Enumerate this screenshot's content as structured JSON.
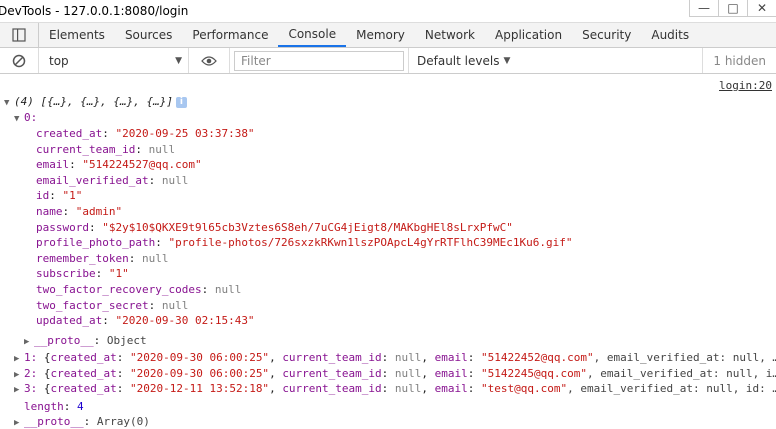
{
  "window": {
    "title": "DevTools - 127.0.0.1:8080/login",
    "min": "—",
    "max": "□",
    "close": "✕"
  },
  "tabs": [
    "Elements",
    "Sources",
    "Performance",
    "Console",
    "Memory",
    "Network",
    "Application",
    "Security",
    "Audits"
  ],
  "active_tab": "Console",
  "toolbar": {
    "context": "top",
    "filter_placeholder": "Filter",
    "levels": "Default levels",
    "hidden": "1 hidden"
  },
  "console": {
    "source": "login:20",
    "summary": "(4) [{…}, {…}, {…}, {…}]",
    "item0_key": "0:",
    "fields": [
      {
        "key": "created_at",
        "value": "\"2020-09-25 03:37:38\"",
        "type": "string"
      },
      {
        "key": "current_team_id",
        "value": "null",
        "type": "null"
      },
      {
        "key": "email",
        "value": "\"514224527@qq.com\"",
        "type": "string"
      },
      {
        "key": "email_verified_at",
        "value": "null",
        "type": "null"
      },
      {
        "key": "id",
        "value": "\"1\"",
        "type": "string"
      },
      {
        "key": "name",
        "value": "\"admin\"",
        "type": "string"
      },
      {
        "key": "password",
        "value": "\"$2y$10$QKXE9t9l65cb3Vztes6S8eh/7uCG4jEigt8/MAKbgHEl8sLrxPfwC\"",
        "type": "string"
      },
      {
        "key": "profile_photo_path",
        "value": "\"profile-photos/726sxzkRKwn1lszPOApcL4gYrRTFlhC39MEc1Ku6.gif\"",
        "type": "string"
      },
      {
        "key": "remember_token",
        "value": "null",
        "type": "null"
      },
      {
        "key": "subscribe",
        "value": "\"1\"",
        "type": "string"
      },
      {
        "key": "two_factor_recovery_codes",
        "value": "null",
        "type": "null"
      },
      {
        "key": "two_factor_secret",
        "value": "null",
        "type": "null"
      },
      {
        "key": "updated_at",
        "value": "\"2020-09-30 02:15:43\"",
        "type": "string"
      }
    ],
    "proto_object": {
      "key": "__proto__",
      "value": "Object"
    },
    "collapsed": [
      {
        "idx": "1",
        "created": "\"2020-09-30 06:00:25\"",
        "email": "\"51422452@qq.com\"",
        "tail": ", email_verified_at: null, …"
      },
      {
        "idx": "2",
        "created": "\"2020-09-30 06:00:25\"",
        "email": "\"5142245@qq.com\"",
        "tail": ", email_verified_at: null, i…"
      },
      {
        "idx": "3",
        "created": "\"2020-12-11 13:52:18\"",
        "email": "\"test@qq.com\"",
        "tail": ", email_verified_at: null, id: …"
      }
    ],
    "length": {
      "key": "length",
      "value": "4"
    },
    "proto_array": {
      "key": "__proto__",
      "value": "Array(0)"
    }
  }
}
